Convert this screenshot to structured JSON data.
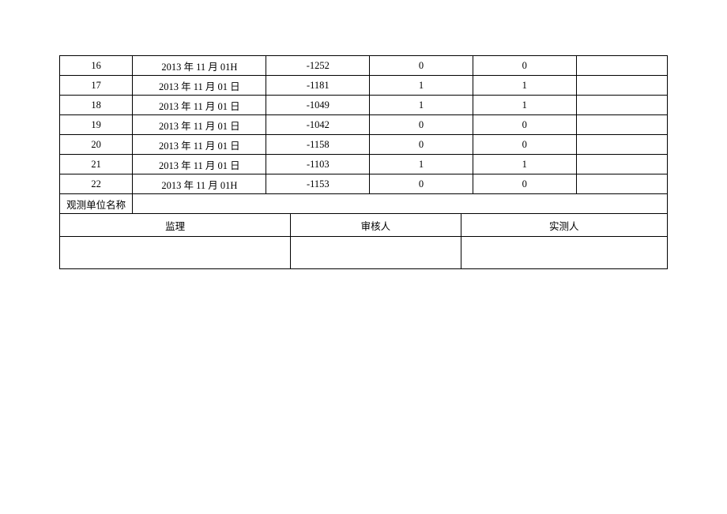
{
  "rows": [
    {
      "idx": "16",
      "date": "2013 年 11 月 01H",
      "v1": "-1252",
      "v2": "0",
      "v3": "0",
      "v4": ""
    },
    {
      "idx": "17",
      "date": "2013 年 11 月 01 日",
      "v1": "-1181",
      "v2": "1",
      "v3": "1",
      "v4": ""
    },
    {
      "idx": "18",
      "date": "2013 年 11 月 01 日",
      "v1": "-1049",
      "v2": "1",
      "v3": "1",
      "v4": ""
    },
    {
      "idx": "19",
      "date": "2013 年 11 月 01 日",
      "v1": "-1042",
      "v2": "0",
      "v3": "0",
      "v4": ""
    },
    {
      "idx": "20",
      "date": "2013 年 11 月 01 日",
      "v1": "-1158",
      "v2": "0",
      "v3": "0",
      "v4": ""
    },
    {
      "idx": "21",
      "date": "2013 年 11 月 01 日",
      "v1": "-1103",
      "v2": "1",
      "v3": "1",
      "v4": ""
    },
    {
      "idx": "22",
      "date": "2013 年 11 月 01H",
      "v1": "-1153",
      "v2": "0",
      "v3": "0",
      "v4": ""
    }
  ],
  "labels": {
    "observationUnit": "观测单位名称",
    "supervisor": "监理",
    "reviewer": "审核人",
    "measurer": "实测人"
  },
  "signatures": {
    "supervisor": "",
    "reviewer": "",
    "measurer": ""
  }
}
